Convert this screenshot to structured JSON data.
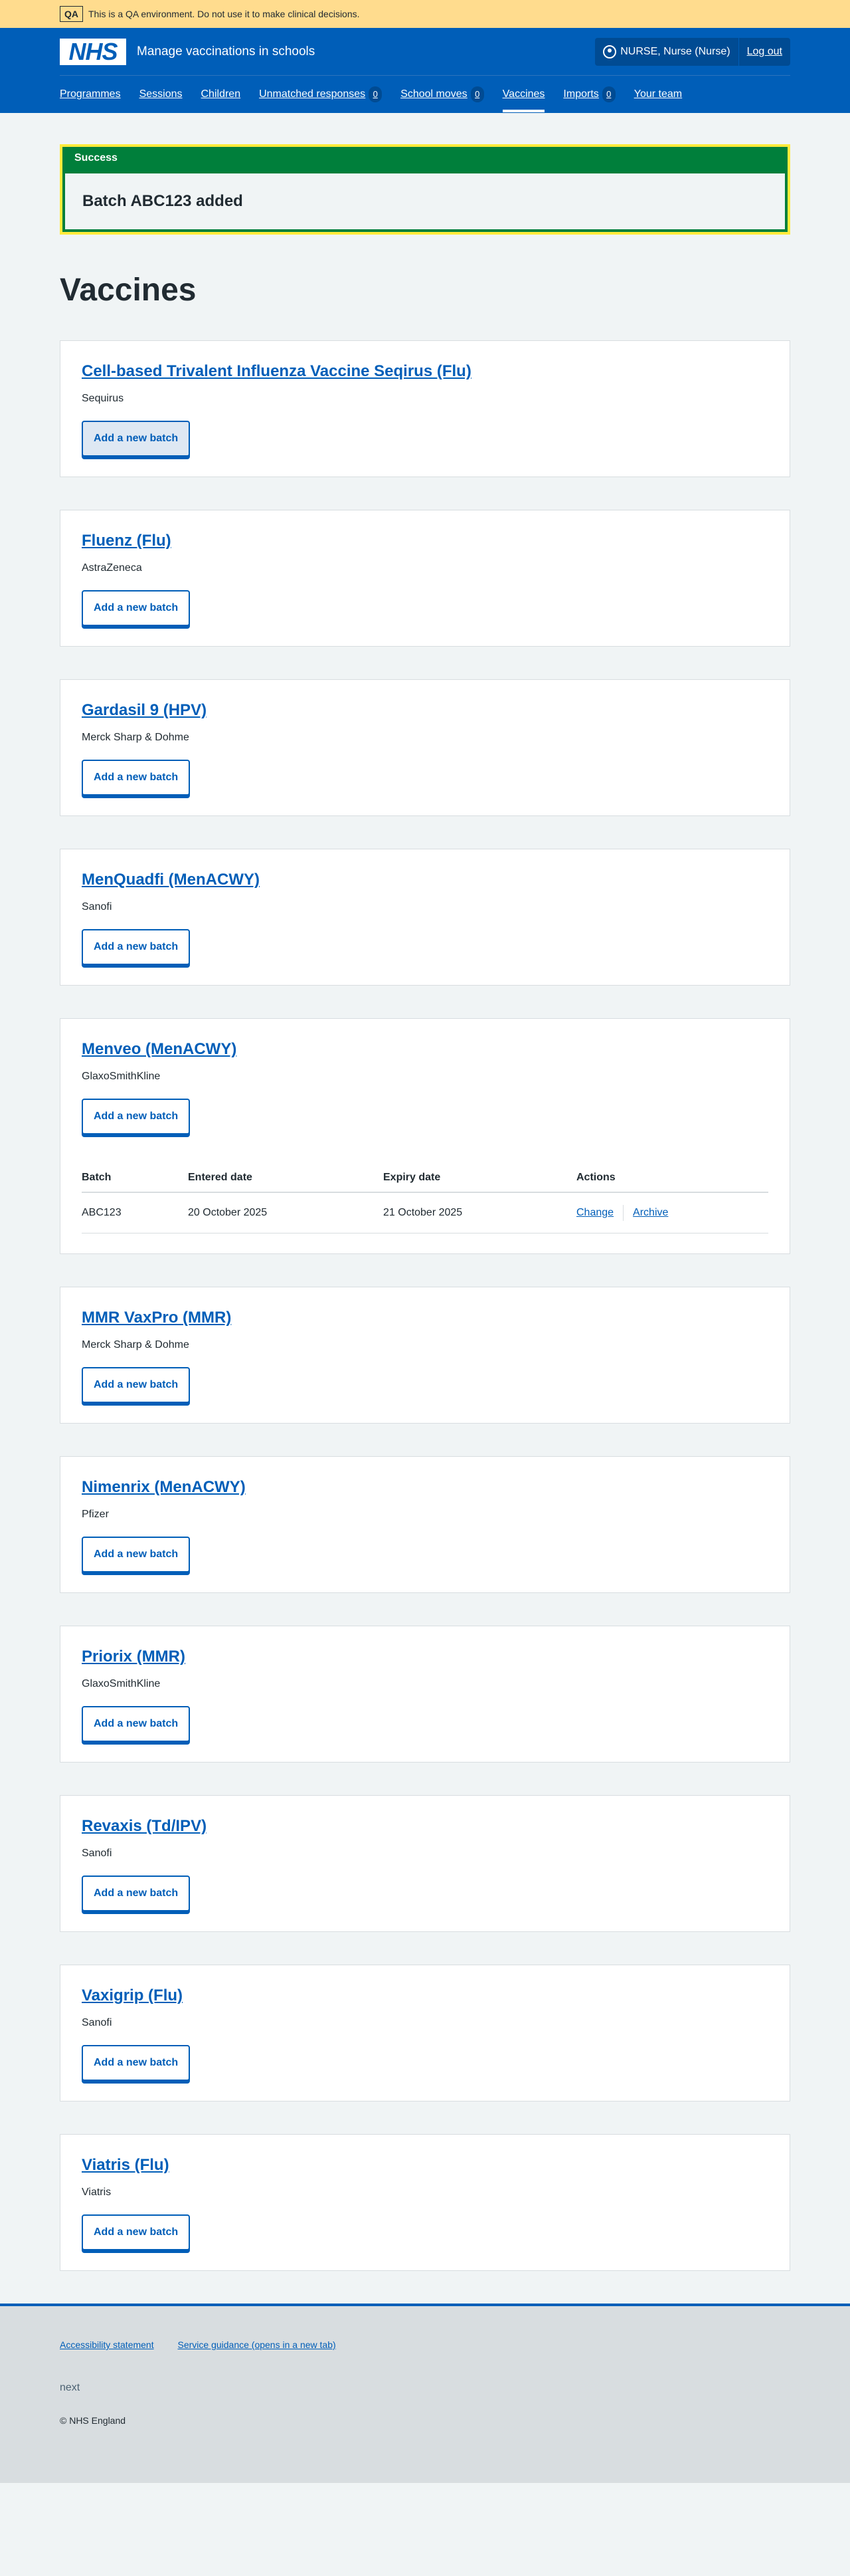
{
  "qa_banner": {
    "tag": "QA",
    "text": "This is a QA environment. Do not use it to make clinical decisions."
  },
  "header": {
    "logo": "NHS",
    "service_name": "Manage vaccinations in schools",
    "user": "NURSE, Nurse (Nurse)",
    "logout": "Log out"
  },
  "nav": [
    {
      "label": "Programmes"
    },
    {
      "label": "Sessions"
    },
    {
      "label": "Children"
    },
    {
      "label": "Unmatched responses",
      "count": "0"
    },
    {
      "label": "School moves",
      "count": "0"
    },
    {
      "label": "Vaccines",
      "active": true
    },
    {
      "label": "Imports",
      "count": "0"
    },
    {
      "label": "Your team"
    }
  ],
  "success": {
    "title": "Success",
    "message": "Batch ABC123 added"
  },
  "page_title": "Vaccines",
  "add_batch_label": "Add a new batch",
  "vaccines": [
    {
      "name": "Cell-based Trivalent Influenza Vaccine Seqirus (Flu)",
      "supplier": "Sequirus"
    },
    {
      "name": "Fluenz (Flu)",
      "supplier": "AstraZeneca"
    },
    {
      "name": "Gardasil 9 (HPV)",
      "supplier": "Merck Sharp & Dohme"
    },
    {
      "name": "MenQuadfi (MenACWY)",
      "supplier": "Sanofi"
    },
    {
      "name": "Menveo (MenACWY)",
      "supplier": "GlaxoSmithKline"
    },
    {
      "name": "MMR VaxPro (MMR)",
      "supplier": "Merck Sharp & Dohme"
    },
    {
      "name": "Nimenrix (MenACWY)",
      "supplier": "Pfizer"
    },
    {
      "name": "Priorix (MMR)",
      "supplier": "GlaxoSmithKline"
    },
    {
      "name": "Revaxis (Td/IPV)",
      "supplier": "Sanofi"
    },
    {
      "name": "Vaxigrip (Flu)",
      "supplier": "Sanofi"
    },
    {
      "name": "Viatris (Flu)",
      "supplier": "Viatris"
    }
  ],
  "batch_table": {
    "headers": [
      "Batch",
      "Entered date",
      "Expiry date",
      "Actions"
    ],
    "rows": [
      {
        "batch": "ABC123",
        "entered": "20 October 2025",
        "expiry": "21 October 2025",
        "change": "Change",
        "archive": "Archive"
      }
    ]
  },
  "footer": {
    "links": [
      "Accessibility statement",
      "Service guidance (opens in a new tab)"
    ],
    "next": "next",
    "copyright": "© NHS England"
  }
}
